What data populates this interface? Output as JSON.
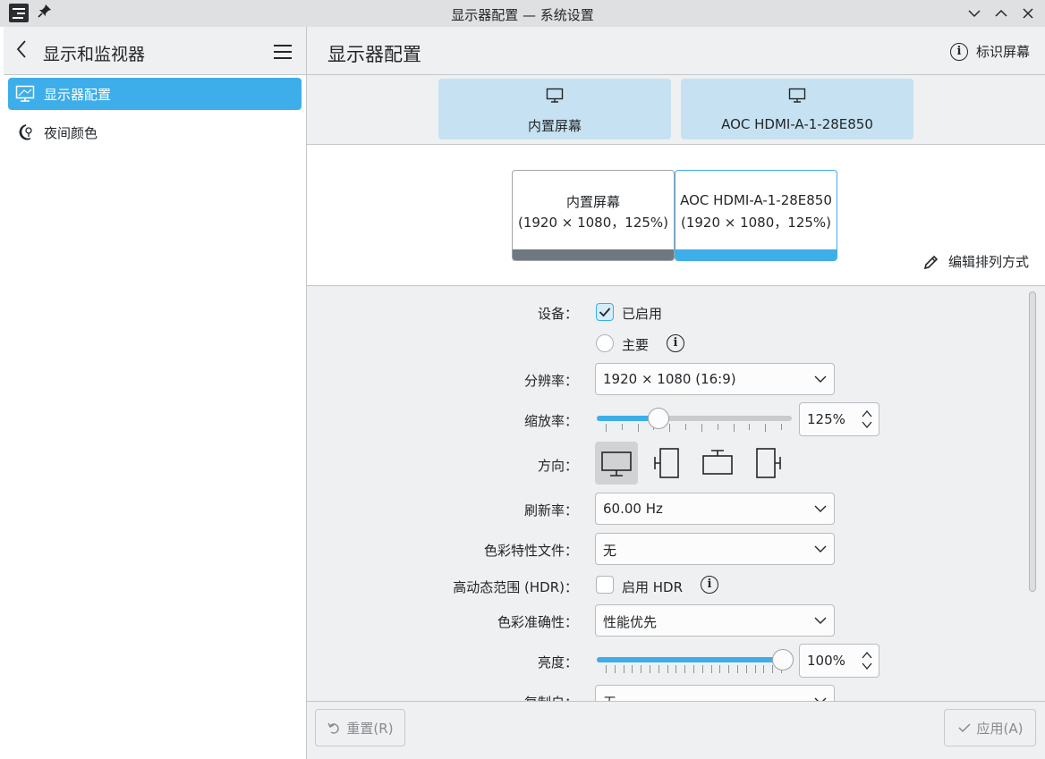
{
  "window": {
    "title": "显示器配置 — 系统设置",
    "pin_glyph": "📌"
  },
  "sidebar": {
    "title": "显示和监视器",
    "back_glyph": "〈",
    "items": [
      {
        "label": "显示器配置",
        "icon": "monitor-icon",
        "active": true
      },
      {
        "label": "夜间颜色",
        "icon": "night-color-icon",
        "active": false
      }
    ]
  },
  "header": {
    "title": "显示器配置",
    "identify_label": "标识屏幕"
  },
  "tabs": [
    {
      "label": "内置屏幕"
    },
    {
      "label": "AOC HDMI-A-1-28E850"
    }
  ],
  "arrangement": {
    "screens": [
      {
        "name": "内置屏幕",
        "res": "(1920 × 1080，125%)"
      },
      {
        "name": "AOC HDMI-A-1-28E850",
        "res": "(1920 × 1080，125%)"
      }
    ],
    "edit_label": "编辑排列方式"
  },
  "form": {
    "device_label": "设备：",
    "enabled_label": "已启用",
    "enabled": true,
    "primary_label": "主要",
    "primary": false,
    "resolution_label": "分辨率：",
    "resolution_value": "1920 × 1080 (16:9)",
    "scale_label": "缩放率：",
    "scale_value": "125%",
    "scale_fraction": 0.3,
    "orientation_label": "方向：",
    "refresh_label": "刷新率：",
    "refresh_value": "60.00 Hz",
    "color_profile_label": "色彩特性文件：",
    "color_profile_value": "无",
    "hdr_label": "高动态范围 (HDR)：",
    "hdr_checkbox_label": "启用 HDR",
    "hdr": false,
    "color_accuracy_label": "色彩准确性：",
    "color_accuracy_value": "性能优先",
    "brightness_label": "亮度：",
    "brightness_value": "100%",
    "brightness_fraction": 1.0,
    "replicate_label": "复制自：",
    "replicate_value": "无"
  },
  "footer": {
    "reset_label": "重置(R)",
    "apply_label": "应用(A)"
  },
  "colors": {
    "accent": "#3daee9",
    "window_bg": "#eff0f1",
    "tab_bg": "#c6e2f2"
  }
}
